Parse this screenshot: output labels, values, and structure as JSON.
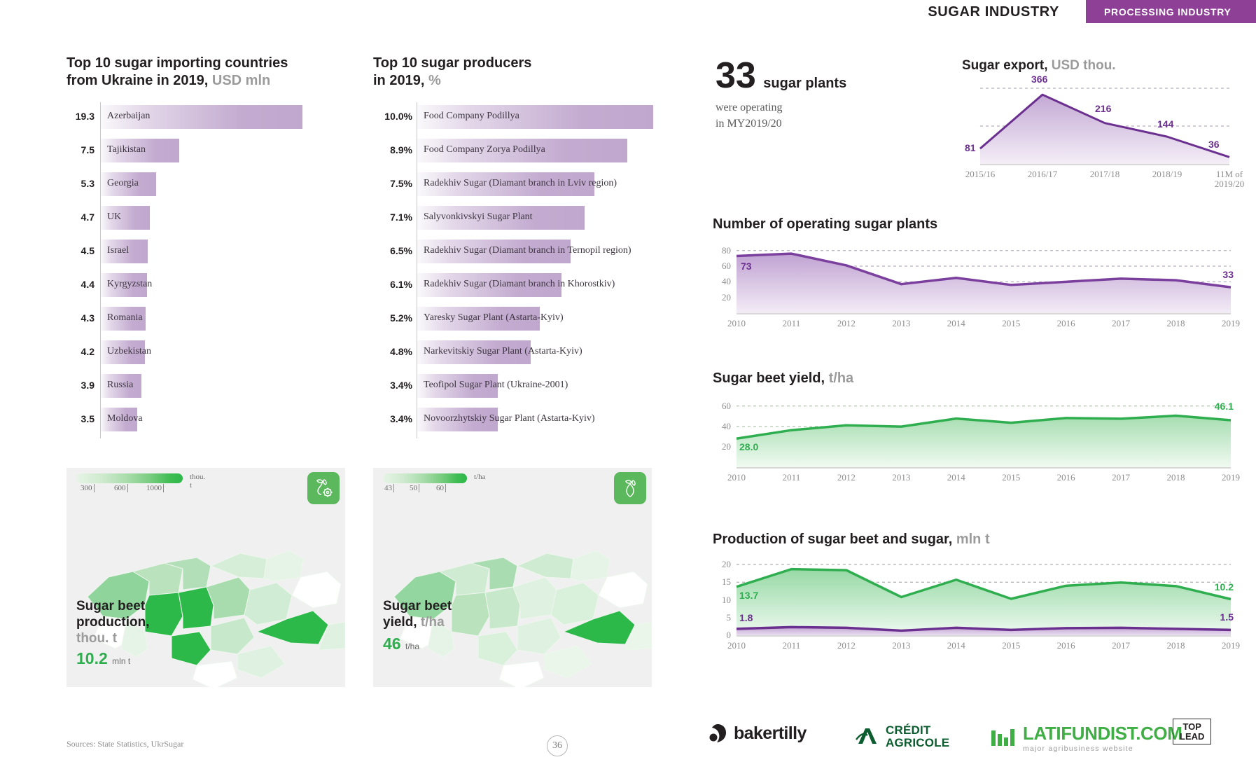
{
  "header": {
    "title": "SUGAR INDUSTRY",
    "badge": "PROCESSING INDUSTRY",
    "badge_color": "#8e3f96"
  },
  "importers": {
    "title_line1": "Top 10 sugar importing countries",
    "title_line2": "from Ukraine in 2019,",
    "unit": "USD mln",
    "items": [
      {
        "value": "19.3",
        "label": "Azerbaijan",
        "num": 19.3
      },
      {
        "value": "7.5",
        "label": "Tajikistan",
        "num": 7.5
      },
      {
        "value": "5.3",
        "label": "Georgia",
        "num": 5.3
      },
      {
        "value": "4.7",
        "label": "UK",
        "num": 4.7
      },
      {
        "value": "4.5",
        "label": "Israel",
        "num": 4.5
      },
      {
        "value": "4.4",
        "label": "Kyrgyzstan",
        "num": 4.4
      },
      {
        "value": "4.3",
        "label": "Romania",
        "num": 4.3
      },
      {
        "value": "4.2",
        "label": "Uzbekistan",
        "num": 4.2
      },
      {
        "value": "3.9",
        "label": "Russia",
        "num": 3.9
      },
      {
        "value": "3.5",
        "label": "Moldova",
        "num": 3.5
      }
    ]
  },
  "producers": {
    "title_line1": "Top 10 sugar producers",
    "title_line2": "in 2019,",
    "unit": "%",
    "items": [
      {
        "value": "10.0%",
        "label": "Food Company Podillya",
        "num": 10.0
      },
      {
        "value": "8.9%",
        "label": "Food Company Zorya Podillya",
        "num": 8.9
      },
      {
        "value": "7.5%",
        "label": "Radekhiv Sugar (Diamant branch in Lviv region)",
        "num": 7.5
      },
      {
        "value": "7.1%",
        "label": "Salyvonkivskyi Sugar Plant",
        "num": 7.1
      },
      {
        "value": "6.5%",
        "label": "Radekhiv Sugar (Diamant branch in Ternopil region)",
        "num": 6.5
      },
      {
        "value": "6.1%",
        "label": "Radekhiv Sugar (Diamant branch in Khorostkiv)",
        "num": 6.1
      },
      {
        "value": "5.2%",
        "label": "Yaresky Sugar Plant (Astarta-Kyiv)",
        "num": 5.2
      },
      {
        "value": "4.8%",
        "label": "Narkevitskiy Sugar Plant (Astarta-Kyiv)",
        "num": 4.8
      },
      {
        "value": "3.4%",
        "label": "Teofipol Sugar Plant (Ukraine-2001)",
        "num": 3.4
      },
      {
        "value": "3.4%",
        "label": "Novoorzhytskiy Sugar Plant (Astarta-Kyiv)",
        "num": 3.4
      }
    ]
  },
  "map_production": {
    "legend_unit": "thou. t",
    "legend_ticks": [
      "300",
      "600",
      "1000"
    ],
    "caption_line1": "Sugar beet",
    "caption_line2": "production,",
    "caption_unit": "thou. t",
    "value": "10.2",
    "value_unit": "mln t",
    "icon": "sugar-beet-plant-icon"
  },
  "map_yield": {
    "legend_unit": "t/ha",
    "legend_ticks": [
      "43",
      "50",
      "60"
    ],
    "caption_line1": "Sugar beet",
    "caption_line2": "yield,",
    "caption_unit": "t/ha",
    "value": "46",
    "value_unit": "t/ha",
    "icon": "sugar-beet-icon"
  },
  "bigstat": {
    "number": "33",
    "number_unit": "sugar plants",
    "sub_line1": "were operating",
    "sub_line2": "in MY2019/20"
  },
  "footer": {
    "sources": "Sources: State Statistics, UkrSugar",
    "page": "36",
    "logos": {
      "bakertilly": "bakertilly",
      "credit_agricole_line1": "CRÉDIT",
      "credit_agricole_line2": "AGRICOLE",
      "latifundist_top": "LATIFUNDIST.COM",
      "latifundist_bottom": "major agribusiness website",
      "toplead_line1": "TOP",
      "toplead_line2": "LEAD"
    }
  },
  "chart_data": [
    {
      "id": "sugar_export",
      "type": "area",
      "title": "Sugar export,",
      "unit": "USD thou.",
      "color": "#6b2f8f",
      "categories": [
        "2015/16",
        "2016/17",
        "2017/18",
        "2018/19",
        "11M of\n2019/20"
      ],
      "values": [
        81,
        366,
        216,
        144,
        36
      ],
      "labels": [
        "81",
        "366",
        "216",
        "144",
        "36"
      ],
      "ylim": [
        0,
        400
      ],
      "grid": true,
      "gridlines": [
        400,
        200
      ]
    },
    {
      "id": "operating_plants",
      "type": "area",
      "title": "Number of operating sugar plants",
      "unit": "",
      "color": "#7b3f9d",
      "categories": [
        "2010",
        "2011",
        "2012",
        "2013",
        "2014",
        "2015",
        "2016",
        "2017",
        "2018",
        "2019"
      ],
      "values": [
        73,
        76,
        61,
        37,
        45,
        36,
        40,
        44,
        42,
        33
      ],
      "first_label": "73",
      "last_label": "33",
      "ylabels": [
        "80",
        "60",
        "40",
        "20"
      ],
      "ylim": [
        0,
        86
      ],
      "grid": true
    },
    {
      "id": "beet_yield",
      "type": "area",
      "title": "Sugar beet yield,",
      "unit": "t/ha",
      "color": "#2fae4f",
      "categories": [
        "2010",
        "2011",
        "2012",
        "2013",
        "2014",
        "2015",
        "2016",
        "2017",
        "2018",
        "2019"
      ],
      "values": [
        28.0,
        36.3,
        41.1,
        39.8,
        47.7,
        43.6,
        48.2,
        47.5,
        50.5,
        46.1
      ],
      "first_label": "28.0",
      "last_label": "46.1",
      "ylabels": [
        "60",
        "40",
        "20"
      ],
      "ylim": [
        0,
        66
      ],
      "grid": true
    },
    {
      "id": "beet_and_sugar_production",
      "type": "area",
      "title": "Production of sugar beet and sugar,",
      "unit": "mln t",
      "categories": [
        "2010",
        "2011",
        "2012",
        "2013",
        "2014",
        "2015",
        "2016",
        "2017",
        "2018",
        "2019"
      ],
      "series": [
        {
          "name": "sugar beet",
          "color": "#2fae4f",
          "values": [
            13.7,
            18.7,
            18.4,
            10.8,
            15.7,
            10.3,
            14.0,
            14.9,
            13.9,
            10.2
          ],
          "first_label": "13.7",
          "last_label": "10.2"
        },
        {
          "name": "sugar",
          "color": "#6b2f8f",
          "values": [
            1.8,
            2.3,
            2.1,
            1.3,
            2.1,
            1.5,
            2.0,
            2.1,
            1.8,
            1.5
          ],
          "first_label": "1.8",
          "last_label": "1.5"
        }
      ],
      "ylabels": [
        "20",
        "15",
        "10",
        "5",
        "0"
      ],
      "ylim": [
        0,
        21
      ],
      "grid": true
    }
  ]
}
